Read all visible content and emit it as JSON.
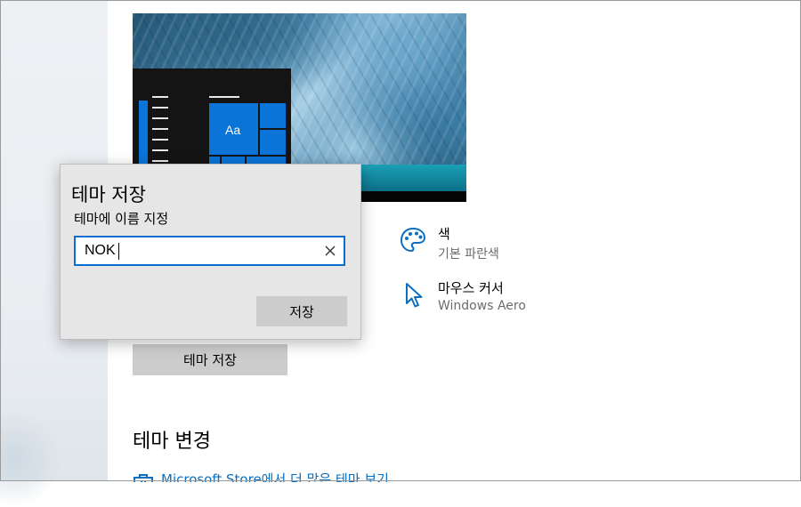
{
  "preview": {
    "tile_text": "Aa"
  },
  "settings": {
    "color": {
      "title": "색",
      "value": "기본 파란색",
      "icon": "palette-icon"
    },
    "cursor": {
      "title": "마우스 커서",
      "value": "Windows Aero",
      "icon": "mouse-pointer-icon"
    },
    "save_theme_label": "테마 저장",
    "change_theme_heading": "테마 변경",
    "store_link": {
      "text": "Microsoft Store에서 더 많은 테마 보기",
      "icon": "store-bag-icon"
    }
  },
  "dialog": {
    "title": "테마 저장",
    "label": "테마에 이름 지정",
    "input_value": "NOK",
    "clear_icon": "close-icon",
    "save_label": "저장"
  },
  "colors": {
    "accent": "#0a74d8",
    "button_gray": "#cccccc",
    "link_blue": "#0a6fc2"
  }
}
